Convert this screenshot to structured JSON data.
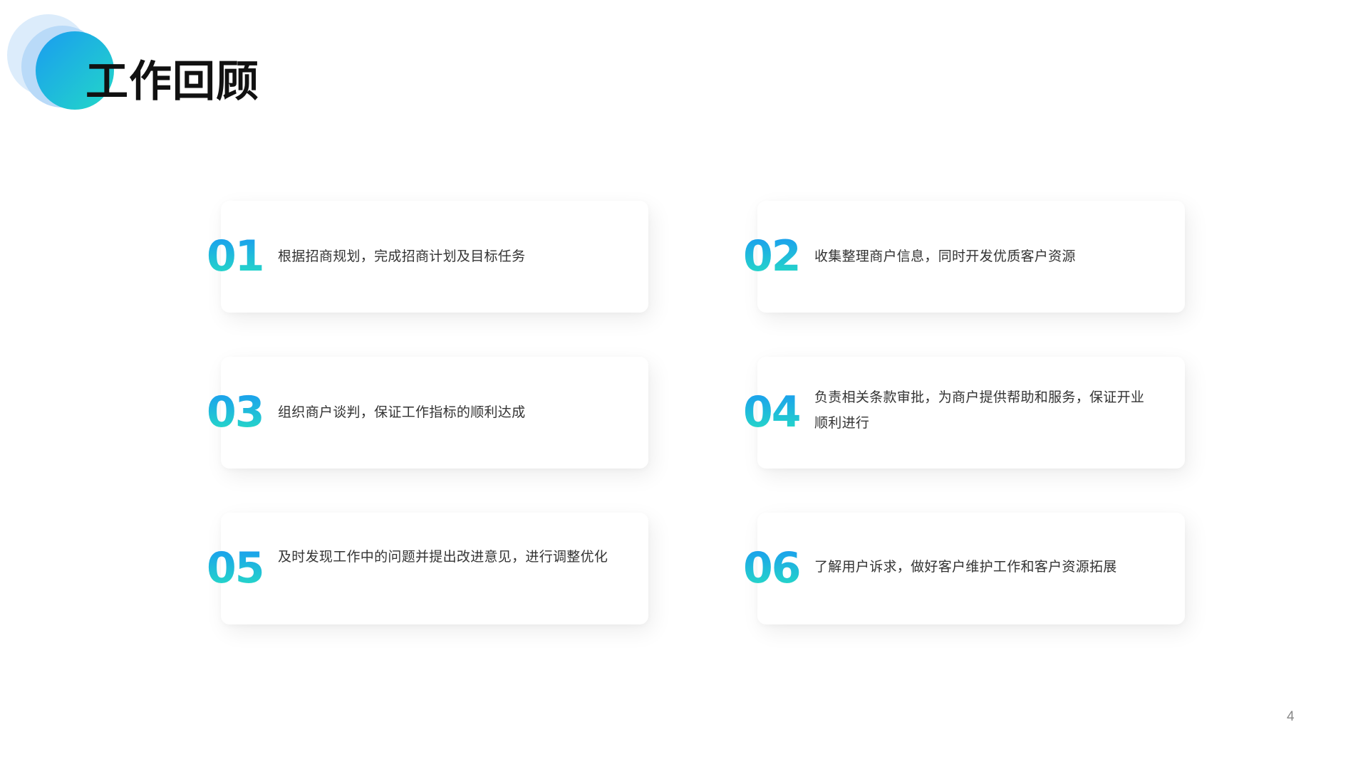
{
  "slide": {
    "title": "工作回顾",
    "page_number": "4",
    "accent_gradient": [
      "#1a9cf0",
      "#26dcc4"
    ]
  },
  "items": [
    {
      "number": "01",
      "text": "根据招商规划，完成招商计划及目标任务"
    },
    {
      "number": "02",
      "text": "收集整理商户信息，同时开发优质客户资源"
    },
    {
      "number": "03",
      "text": "组织商户谈判，保证工作指标的顺利达成"
    },
    {
      "number": "04",
      "text": "负责相关条款审批，为商户提供帮助和服务，保证开业顺利进行"
    },
    {
      "number": "05",
      "text": "及时发现工作中的问题并提出改进意见，进行调整优化"
    },
    {
      "number": "06",
      "text": "了解用户诉求，做好客户维护工作和客户资源拓展"
    }
  ]
}
